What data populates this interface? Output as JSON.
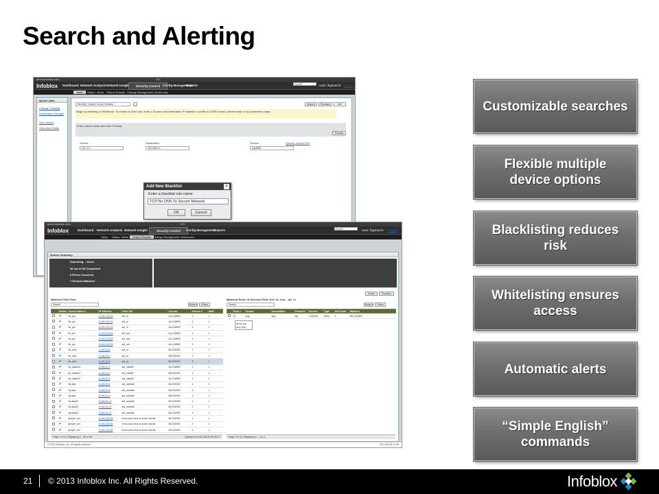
{
  "slide": {
    "title": "Search and Alerting",
    "features": [
      "Customizable searches",
      "Flexible multiple device options",
      "Blacklisting reduces risk",
      "Whitelisting ensures access",
      "Automatic alerts",
      "“Simple English” commands"
    ],
    "footer": {
      "page_number": "21",
      "copyright": "© 2013 Infoblox Inc. All Rights Reserved.",
      "logo_text": "Infoblox"
    },
    "colors": {
      "button_gradient_top": "#8a8a8a",
      "button_gradient_bottom": "#5a5a5a",
      "footer_bg": "#000000",
      "logo_green": "#7ab648",
      "logo_blue": "#1e88c8"
    }
  },
  "app_back": {
    "host": "demo.infoblox.com",
    "env": "IOC",
    "logo": "Infoblox",
    "nav": [
      "Dashboard",
      "Network Analysis",
      "Network Insight",
      "Security Control",
      "Config Management",
      "Reports"
    ],
    "active_nav": "Security Control",
    "subnav": [
      "Tasks",
      "Status",
      "Alerts",
      "Search Results",
      "Change Management",
      "Workbooks"
    ],
    "search_placeholder": "Find/IP",
    "user": "User: ihgsearch",
    "logout": "Logout",
    "quick_links_title": "Quick Links",
    "quick_links": [
      "Change Tracking",
      "Scheduled Changes",
      "View Issues",
      "View Alert Rules"
    ],
    "group_select": "Security_Control_Group_Devices",
    "btn_search": "Search",
    "btn_provision": "Provision",
    "btn_alert": "Alert",
    "instructions": "Begin by selecting a Workbook. To create an Alert rule, enter a Source and Destination IP address or prefix in CIDR format, subnet mask or by ip address range...",
    "section_label": "Enter values below and click Preview",
    "btn_preview": "Preview",
    "source_label": "Source",
    "source_value": "10.1.2.1",
    "dest_label": "Destination",
    "dest_value": "192.168.4.1",
    "service_label": "Service",
    "service_value": "tcp/8080",
    "specify_source_port": "Specify Source Port",
    "dialog": {
      "title": "Add New Blacklist",
      "label": "Enter a blacklist rule name",
      "value": "TCP No DNS To Secure Network",
      "ok": "OK",
      "cancel": "Cancel"
    }
  },
  "app_front": {
    "host": "demo.infoblox.com",
    "env": "IOC",
    "logo": "Infoblox",
    "nav": [
      "Dashboard",
      "Network Analysis",
      "Network Insight",
      "Security Control",
      "Config Management",
      "Reports"
    ],
    "active_nav": "Security Control",
    "subnav": [
      "Tasks",
      "Status",
      "Alerts",
      "Search Results",
      "Change Management",
      "Workbooks"
    ],
    "active_subnav": "Search Results",
    "search_placeholder": "Find/IP",
    "user": "User: ihgsearch",
    "logout": "Logout",
    "summary_title": "Search Summary",
    "summary_lines": [
      "Searching.....Done",
      "36 out of 36 Completed",
      "0 Errors Occurred",
      "7 Devices Matched"
    ],
    "btn_reset": "Reset",
    "btn_provision": "Provision",
    "left_grid_title": "Matched Filter Sets",
    "right_grid_title": "Matched Rules of Selected Filter Set: fw_ios1 - acl_in",
    "search_label": "Search",
    "views_label": "Views ▾",
    "filters_label": "Filters",
    "left_columns": [
      "",
      "Status",
      "Device Name ▴",
      "IP Address",
      "Filter Set",
      "Access",
      "Search #",
      "Matc"
    ],
    "left_rows": [
      [
        "fw_pix",
        "10.66.100.53",
        "acl_in",
        "ALLOWED",
        "1",
        "1"
      ],
      [
        "fw_pix",
        "10.66.100.53",
        "acl_in",
        "ALLOWED",
        "2",
        "1"
      ],
      [
        "fw_pix",
        "10.66.100.53",
        "acl_in",
        "ALLOWED",
        "3",
        "1"
      ],
      [
        "fw_pix",
        "10.66.100.53",
        "acl_out",
        "ALLOWED",
        "1",
        "1"
      ],
      [
        "fw_pix",
        "10.66.100.53",
        "acl_out",
        "ALLOWED",
        "2",
        "1"
      ],
      [
        "fw_pix",
        "10.66.100.53",
        "acl_out",
        "ALLOWED",
        "3",
        "1"
      ],
      [
        "fw_ios1",
        "10.66.52.6",
        "acl_in",
        "BLOCKED",
        "1",
        "1"
      ],
      [
        "fw_ios1",
        "10.66.52.6",
        "acl_in",
        "BLOCKED",
        "2",
        "1"
      ],
      [
        "fw_ios1",
        "10.66.52.6",
        "acl_in",
        "BLOCKED",
        "3",
        "1"
      ],
      [
        "fw_switch2",
        "10.66.52.9",
        "acl_vlan50",
        "ALLOWED",
        "1",
        "1"
      ],
      [
        "fw_switch2",
        "10.66.52.9",
        "acl_vlan50",
        "BLOCKED",
        "2",
        "1"
      ],
      [
        "fw_switch2",
        "10.66.52.9",
        "acl_vlan50",
        "ALLOWED",
        "3",
        "1"
      ],
      [
        "fnj-asa",
        "10.66.52.8",
        "acl_outside",
        "BLOCKED",
        "1",
        "1"
      ],
      [
        "fnj-asa",
        "10.66.52.8",
        "acl_outside",
        "BLOCKED",
        "2",
        "1"
      ],
      [
        "fnj-asa",
        "10.66.52.8",
        "acl_outside",
        "BLOCKED",
        "3",
        "1"
      ],
      [
        "fnj-asa22",
        "10.66.52.10",
        "acl_outside",
        "BLOCKED",
        "1",
        "1"
      ],
      [
        "fnj-asa22",
        "10.66.52.10",
        "acl_outside",
        "BLOCKED",
        "2",
        "1"
      ],
      [
        "fnj-asa22",
        "10.66.52.10",
        "acl_outside",
        "BLOCKED",
        "3",
        "1"
      ],
      [
        "juniper_srx",
        "10.66.100.55",
        "from-zone dmz to-zone untrust",
        "BLOCKED",
        "1",
        "1"
      ],
      [
        "juniper_srx",
        "10.66.100.55",
        "from-zone dmz to-zone untrust",
        "BLOCKED",
        "2",
        "1"
      ],
      [
        "juniper_srx",
        "10.66.100.55",
        "from-zone dmz to-zone untrust",
        "BLOCKED",
        "3",
        "1"
      ]
    ],
    "selected_row": 8,
    "right_columns": [
      "",
      "Rule #",
      "Source",
      "Destination",
      "Protocol",
      "Service",
      "Type",
      "Hit Count",
      "Matches"
    ],
    "right_rows": [
      [
        "10",
        "any",
        "any",
        "tcp",
        "0-65535",
        "Deny",
        "0",
        "INCLUDED"
      ]
    ],
    "tooltip": "deny tcp any any",
    "left_pager": "Page 1 of 1 | Displaying 1 - 36 of 36",
    "left_updated": "Updated at 2013-06-05 08:40:27",
    "right_pager": "Page 1 of 1 | Displaying 1 - 1 of 1",
    "copyright": "© 2013 Infoblox, Inc. All rights reserved.",
    "timestamp": "2013-06-05 11:08"
  }
}
